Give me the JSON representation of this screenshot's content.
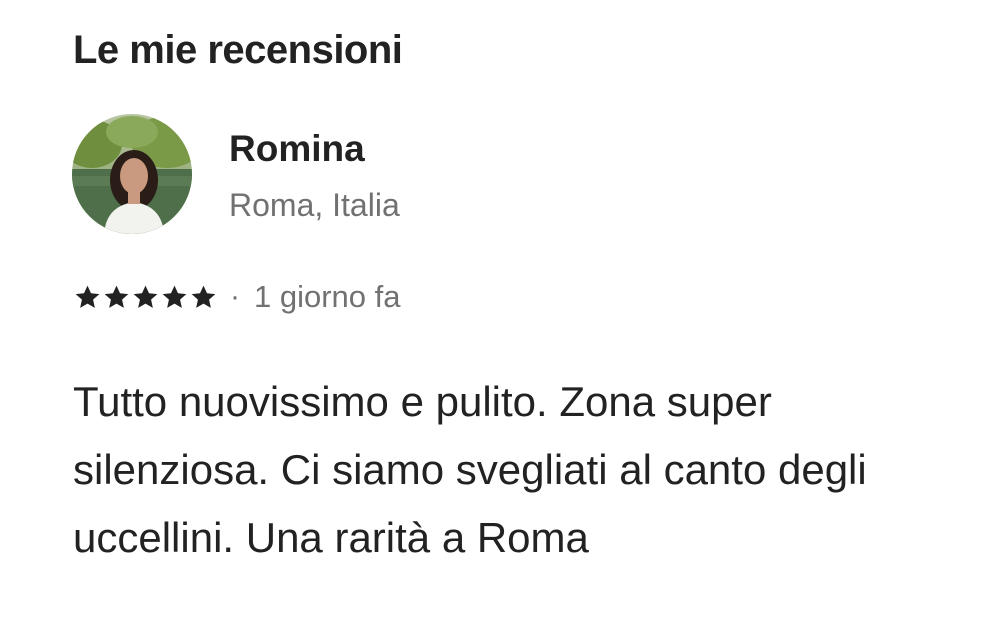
{
  "page": {
    "title": "Le mie recensioni"
  },
  "review": {
    "reviewer": {
      "name": "Romina",
      "location": "Roma, Italia"
    },
    "rating": 5,
    "rating_max": 5,
    "separator": "·",
    "time": "1 giorno fa",
    "text": "Tutto nuovissimo e pulito. Zona super silenziosa. Ci siamo svegliati al canto degli uccellini. Una rarità a Roma"
  },
  "icons": {
    "star": "star-icon",
    "avatar": "user-photo"
  },
  "colors": {
    "primary_text": "#222222",
    "secondary_text": "#717171",
    "background": "#ffffff"
  }
}
